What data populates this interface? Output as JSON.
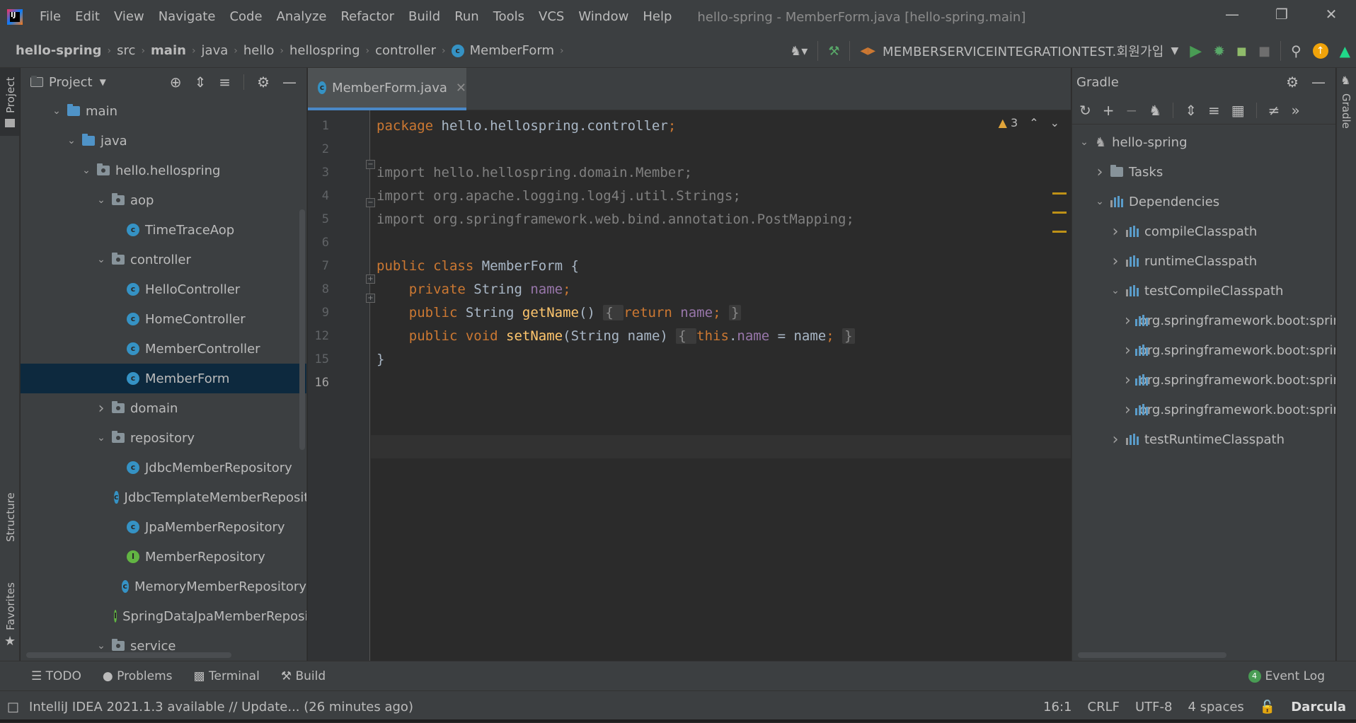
{
  "app": {
    "window_title": "hello-spring - MemberForm.java [hello-spring.main]",
    "logo_text": "IJ",
    "menu": [
      "File",
      "Edit",
      "View",
      "Navigate",
      "Code",
      "Analyze",
      "Refactor",
      "Build",
      "Run",
      "Tools",
      "VCS",
      "Window",
      "Help"
    ]
  },
  "breadcrumbs": [
    "hello-spring",
    "src",
    "main",
    "java",
    "hello",
    "hellospring",
    "controller",
    "MemberForm"
  ],
  "toolbar": {
    "run_configuration": "MEMBERSERVICEINTEGRATIONTEST.회원가입"
  },
  "project_panel": {
    "title": "Project",
    "tree": [
      {
        "label": "main",
        "type": "folder-blue",
        "depth": 0,
        "expanded": true
      },
      {
        "label": "java",
        "type": "folder-blue",
        "depth": 1,
        "expanded": true
      },
      {
        "label": "hello.hellospring",
        "type": "package",
        "depth": 2,
        "expanded": true
      },
      {
        "label": "aop",
        "type": "package",
        "depth": 3,
        "expanded": true
      },
      {
        "label": "TimeTraceAop",
        "type": "class",
        "depth": 4
      },
      {
        "label": "controller",
        "type": "package",
        "depth": 3,
        "expanded": true
      },
      {
        "label": "HelloController",
        "type": "class",
        "depth": 4
      },
      {
        "label": "HomeController",
        "type": "class",
        "depth": 4
      },
      {
        "label": "MemberController",
        "type": "class",
        "depth": 4
      },
      {
        "label": "MemberForm",
        "type": "class",
        "depth": 4,
        "selected": true
      },
      {
        "label": "domain",
        "type": "package",
        "depth": 3,
        "expanded": false
      },
      {
        "label": "repository",
        "type": "package",
        "depth": 3,
        "expanded": true
      },
      {
        "label": "JdbcMemberRepository",
        "type": "class",
        "depth": 4
      },
      {
        "label": "JdbcTemplateMemberRepository",
        "type": "class",
        "depth": 4
      },
      {
        "label": "JpaMemberRepository",
        "type": "class",
        "depth": 4
      },
      {
        "label": "MemberRepository",
        "type": "interface",
        "depth": 4
      },
      {
        "label": "MemoryMemberRepository",
        "type": "class",
        "depth": 4
      },
      {
        "label": "SpringDataJpaMemberRepository",
        "type": "interface",
        "depth": 4
      },
      {
        "label": "service",
        "type": "package",
        "depth": 3,
        "expanded": true
      }
    ]
  },
  "editor": {
    "tab_label": "MemberForm.java",
    "warnings_count": "3",
    "lines": [
      {
        "no": "1",
        "parts": [
          {
            "t": "package ",
            "c": "kw"
          },
          {
            "t": "hello.hellospring.controller",
            "c": ""
          },
          {
            "t": ";",
            "c": "kw"
          }
        ]
      },
      {
        "no": "2",
        "parts": []
      },
      {
        "no": "3",
        "parts": [
          {
            "t": "import hello.hellospring.domain.Member;",
            "c": "dim"
          }
        ]
      },
      {
        "no": "4",
        "parts": [
          {
            "t": "import org.apache.logging.log4j.util.Strings;",
            "c": "dim"
          }
        ]
      },
      {
        "no": "5",
        "parts": [
          {
            "t": "import org.springframework.web.bind.annotation.PostMapping;",
            "c": "dim"
          }
        ]
      },
      {
        "no": "6",
        "parts": []
      },
      {
        "no": "7",
        "parts": [
          {
            "t": "public class ",
            "c": "kw"
          },
          {
            "t": "MemberForm {",
            "c": ""
          }
        ]
      },
      {
        "no": "8",
        "parts": [
          {
            "t": "    private ",
            "c": "kw"
          },
          {
            "t": "String ",
            "c": ""
          },
          {
            "t": "name",
            "c": "mem"
          },
          {
            "t": ";",
            "c": "kw"
          }
        ]
      },
      {
        "no": "9",
        "parts": [
          {
            "t": "    public ",
            "c": "kw"
          },
          {
            "t": "String ",
            "c": ""
          },
          {
            "t": "getName",
            "c": "fn"
          },
          {
            "t": "() ",
            "c": ""
          },
          {
            "t": "{ ",
            "c": "fold"
          },
          {
            "t": "return ",
            "c": "kw"
          },
          {
            "t": "name",
            "c": "mem"
          },
          {
            "t": "; ",
            "c": "kw"
          },
          {
            "t": "}",
            "c": "fold"
          }
        ]
      },
      {
        "no": "12",
        "parts": [
          {
            "t": "    public ",
            "c": "kw"
          },
          {
            "t": "void ",
            "c": "kw"
          },
          {
            "t": "setName",
            "c": "fn"
          },
          {
            "t": "(String name) ",
            "c": ""
          },
          {
            "t": "{ ",
            "c": "fold"
          },
          {
            "t": "this",
            "c": "kw"
          },
          {
            "t": ".",
            "c": ""
          },
          {
            "t": "name",
            "c": "mem"
          },
          {
            "t": " = name",
            "c": ""
          },
          {
            "t": "; ",
            "c": "kw"
          },
          {
            "t": "}",
            "c": "fold"
          }
        ]
      },
      {
        "no": "15",
        "parts": [
          {
            "t": "}",
            "c": ""
          }
        ]
      },
      {
        "no": "16",
        "parts": []
      }
    ]
  },
  "gradle_panel": {
    "title": "Gradle",
    "tree": [
      {
        "label": "hello-spring",
        "type": "elephant",
        "depth": 0,
        "expanded": true
      },
      {
        "label": "Tasks",
        "type": "folder-gear",
        "depth": 1,
        "expanded": false
      },
      {
        "label": "Dependencies",
        "type": "lib",
        "depth": 1,
        "expanded": true
      },
      {
        "label": "compileClasspath",
        "type": "lib",
        "depth": 2,
        "expanded": false
      },
      {
        "label": "runtimeClasspath",
        "type": "lib",
        "depth": 2,
        "expanded": false
      },
      {
        "label": "testCompileClasspath",
        "type": "lib",
        "depth": 2,
        "expanded": true
      },
      {
        "label": "org.springframework.boot:spring-boot-starter-thymeleaf",
        "type": "libbars",
        "depth": 3,
        "expanded": false
      },
      {
        "label": "org.springframework.boot:spring-boot-starter-web",
        "type": "libbars",
        "depth": 3,
        "expanded": false
      },
      {
        "label": "org.springframework.boot:spring-boot-starter-data-jpa",
        "type": "libbars",
        "depth": 3,
        "expanded": false
      },
      {
        "label": "org.springframework.boot:spring-boot-starter-test",
        "type": "libbars",
        "depth": 3,
        "expanded": false
      },
      {
        "label": "testRuntimeClasspath",
        "type": "lib",
        "depth": 2,
        "expanded": false
      }
    ]
  },
  "side_stripes": {
    "left_top": "Project",
    "left_structure": "Structure",
    "left_favorites": "Favorites",
    "right_top": "Gradle"
  },
  "bottom_tools": {
    "todo": "TODO",
    "problems": "Problems",
    "terminal": "Terminal",
    "build": "Build",
    "event_log": "Event Log",
    "event_count": "4"
  },
  "status": {
    "message": "IntelliJ IDEA 2021.1.3 available // Update... (26 minutes ago)",
    "position": "16:1",
    "line_sep": "CRLF",
    "encoding": "UTF-8",
    "indent": "4 spaces",
    "theme": "Darcula"
  }
}
